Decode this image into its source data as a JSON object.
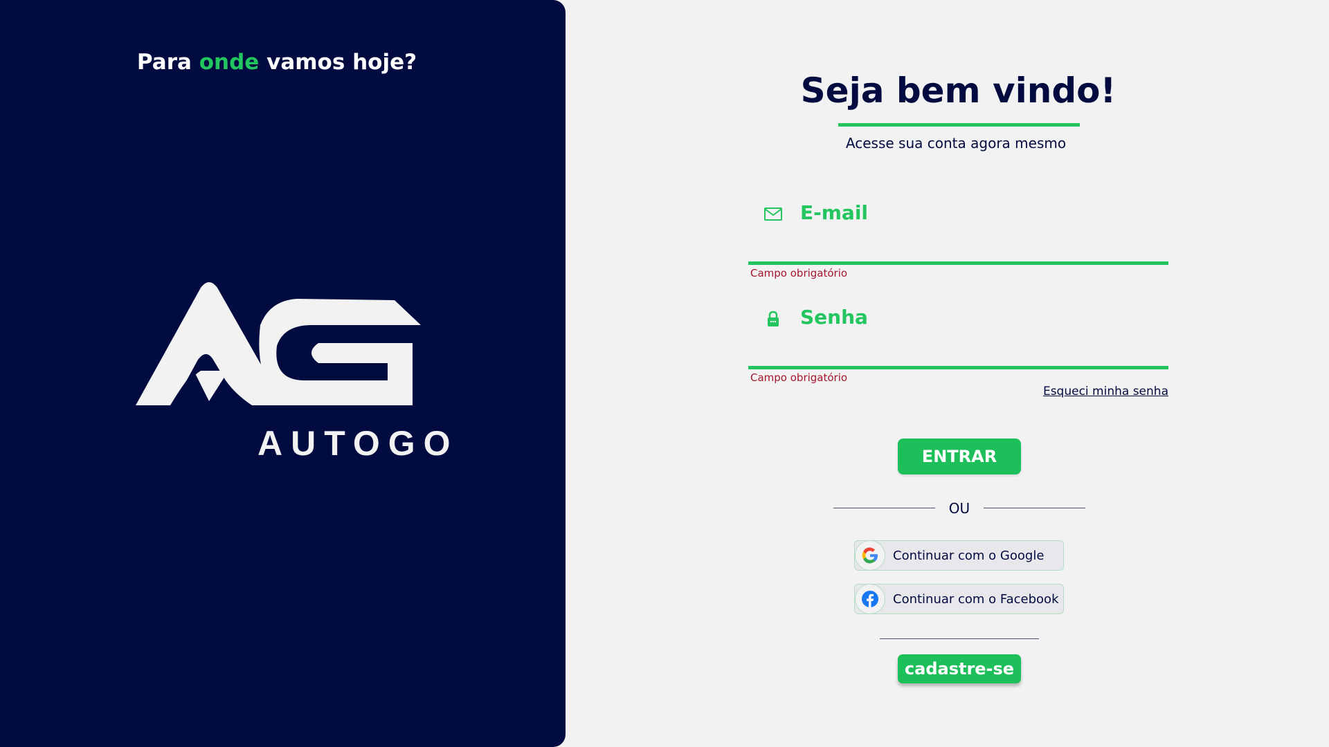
{
  "left_panel": {
    "tagline_before": "Para",
    "tagline_accent": "onde",
    "tagline_after": "vamos hoje?",
    "brand_name": "AUTOGO",
    "logo_icon": "autogo-ag-logo"
  },
  "login": {
    "title": "Seja bem vindo!",
    "subtitle": "Acesse sua conta agora mesmo",
    "email": {
      "placeholder": "E-mail",
      "value": "",
      "icon": "mail-icon",
      "error": "Campo obrigatório"
    },
    "password": {
      "placeholder": "Senha",
      "value": "",
      "icon": "lock-icon",
      "error": "Campo obrigatório"
    },
    "forgot_label": "Esqueci minha senha",
    "submit_label": "ENTRAR",
    "divider_label": "OU",
    "google_label": "Continuar com o Google",
    "facebook_label": "Continuar com o Facebook",
    "signup_label": "cadastre-se"
  },
  "colors": {
    "navy": "#020b3f",
    "green": "#22c55e",
    "error": "#a3162e",
    "background": "#f2f2f2"
  }
}
